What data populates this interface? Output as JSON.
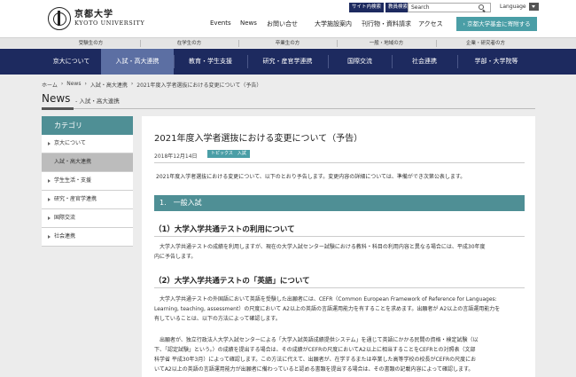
{
  "header": {
    "logo_jp": "京都大学",
    "logo_en": "KYOTO UNIVERSITY",
    "top_links": [
      "サイト内検索",
      "教員検索"
    ],
    "search_value": "Search",
    "language_label": "Language",
    "util_nav": [
      "Events",
      "News",
      "お問い合せ",
      "大学施設案内",
      "刊行物・資料請求",
      "アクセス"
    ],
    "fund_button": "京都大学基金に寄附する"
  },
  "audience": [
    "受験生の方",
    "在学生の方",
    "卒業生の方",
    "一般・地域の方",
    "企業・研究者の方"
  ],
  "main_nav": [
    "京大について",
    "入試・高大連携",
    "教育・学生支援",
    "研究・産官学連携",
    "国際交流",
    "社会連携",
    "学部・大学院等"
  ],
  "main_nav_active": 1,
  "breadcrumb": [
    "ホーム",
    "›",
    "News",
    "›",
    "入試・高大連携",
    "›",
    "2021年度入学者選抜における変更について（予告）"
  ],
  "page": {
    "title": "News",
    "subtitle": "- 入試・高大連携"
  },
  "sidebar": {
    "heading": "カテゴリ",
    "items": [
      "京大について",
      "入試・高大連携",
      "学生生活・支援",
      "研究・産官学連携",
      "国際交流",
      "社会連携"
    ],
    "active": 1
  },
  "article": {
    "title": "2021年度入学者選抜における変更について（予告）",
    "date": "2018年12月14日",
    "tag": "トピックス　入試",
    "intro": "2021年度入学者選抜における変更について、以下のとおり予告します。変更内容の詳細については、準備ができ次第公表します。",
    "section1": "1.　一般入試",
    "sub1": {
      "heading": "（1）大学入学共通テストの利用について",
      "lines": [
        "　大学入学共通テストの成績を利用しますが、現在の大学入試センター試験における教科・科目の利用内容と異なる場合には、平成30年度",
        "内に予告します。"
      ]
    },
    "sub2": {
      "heading": "（2）大学入学共通テストの「英語」について",
      "para1": [
        "　大学入学共通テストの外国語において英語を受験した出願者には、CEFR（Common European Framework of Reference for Languages:",
        "Learning, teaching, assessment）の尺度において A2以上の英語の言語運用能力を有することを求めます。出願者が A2以上の言語運用能力を",
        "有していることは、以下の方法によって確認します。"
      ],
      "para2": [
        "　出願者が、独立行政法人大学入試センターによる「大学入試英語成績提供システム」を通じて英語にかかる民間の資格・検定試験（以",
        "下、「認定試験」という。）の成績を提出する場合は、その成績がCEFRの尺度においてA2以上に相当することをCEFRとの対照表（文部",
        "科学省 平成30年3月）によって確認します。この方法に代えて、出願者が、在学するまたは卒業した高等学校の校長がCEFRの尺度にお",
        "いてA2以上の英語の言語運用能力が出願者に備わっていると認める書類を提出する場合は、その書類の記載内容によって確認します。"
      ]
    }
  }
}
